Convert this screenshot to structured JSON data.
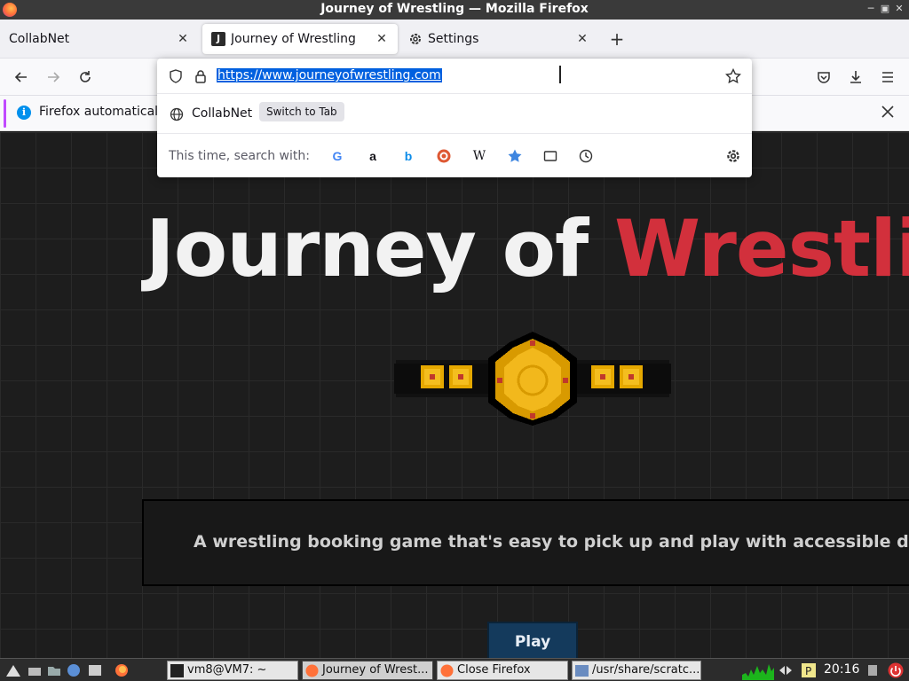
{
  "window": {
    "title": "Journey of Wrestling — Mozilla Firefox"
  },
  "tabs": [
    {
      "label": "CollabNet",
      "active": false
    },
    {
      "label": "Journey of Wrestling",
      "active": true,
      "favicon": "J"
    },
    {
      "label": "Settings",
      "active": false
    }
  ],
  "urlbar": {
    "url": "https://www.journeyofwrestling.com",
    "suggestion": {
      "name": "CollabNet",
      "action": "Switch to Tab"
    },
    "search_label": "This time, search with:",
    "engines": [
      "google",
      "amazon",
      "bing",
      "duckduckgo",
      "wikipedia",
      "bookmarks",
      "tabs",
      "history"
    ]
  },
  "notification": {
    "text": "Firefox automatically"
  },
  "page": {
    "title_part1": "Journey of ",
    "title_part2": "Wrestling",
    "tagline": "A wrestling booking game that's easy to pick up and play with accessible depth.",
    "play_label": "Play"
  },
  "taskbar": {
    "tasks": [
      {
        "label": "vm8@VM7: ~"
      },
      {
        "label": "Journey of Wrest..."
      },
      {
        "label": "Close Firefox"
      },
      {
        "label": "/usr/share/scratc..."
      }
    ],
    "clock": "20:16"
  },
  "colors": {
    "accent_red": "#d2303c",
    "link_blue": "#0060df",
    "play_bg": "#143a5c"
  }
}
